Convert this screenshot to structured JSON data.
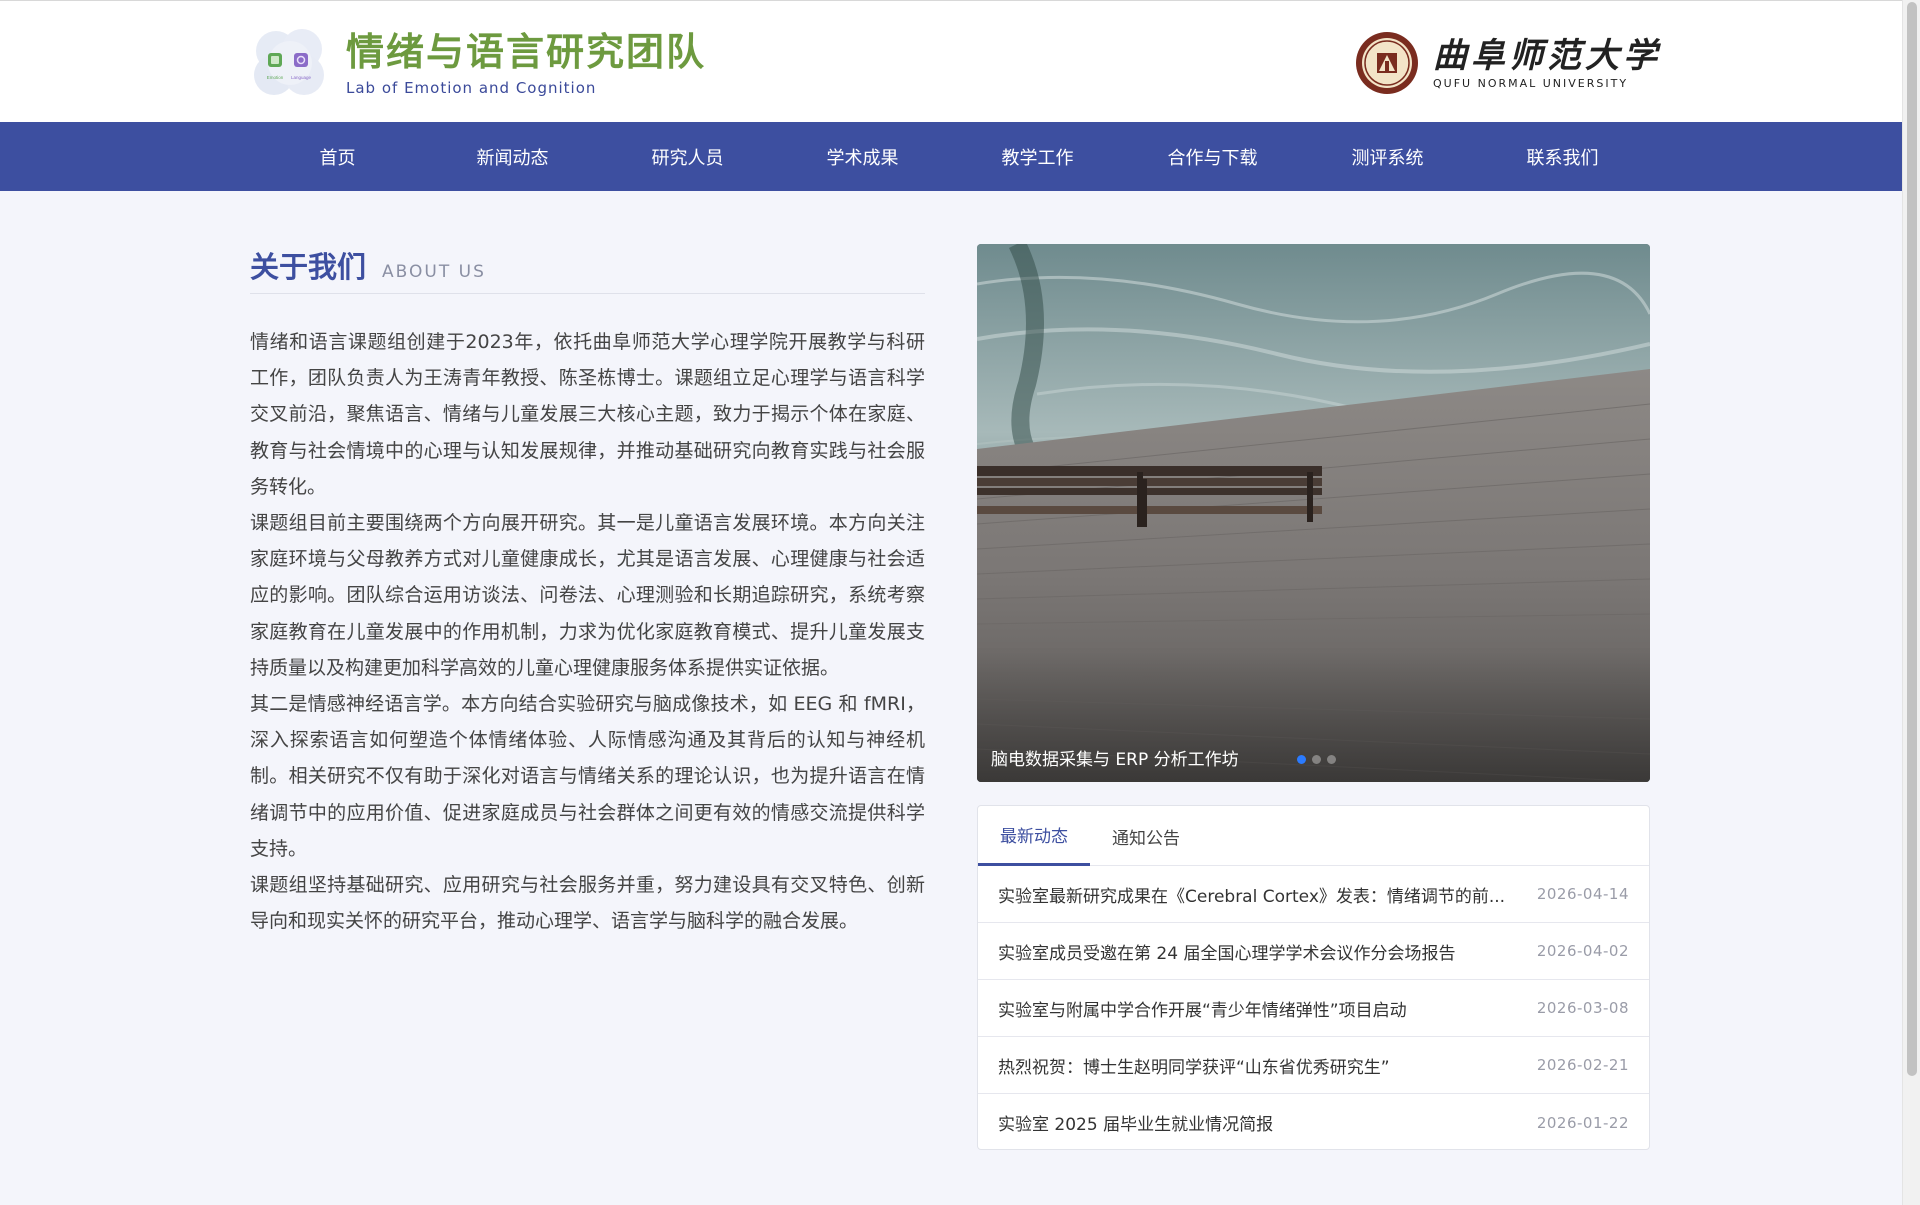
{
  "header": {
    "brand_title": "情绪与语言研究团队",
    "brand_subtitle": "Lab of Emotion and Cognition",
    "logo_labels": [
      "Emotion",
      "Language"
    ],
    "university_cn": "曲阜师范大学",
    "university_en": "QUFU NORMAL UNIVERSITY"
  },
  "nav": {
    "items": [
      {
        "label": "首页"
      },
      {
        "label": "新闻动态"
      },
      {
        "label": "研究人员"
      },
      {
        "label": "学术成果"
      },
      {
        "label": "教学工作"
      },
      {
        "label": "合作与下载"
      },
      {
        "label": "测评系统"
      },
      {
        "label": "联系我们"
      }
    ]
  },
  "about": {
    "title": "关于我们",
    "title_en": "ABOUT US",
    "paragraphs": [
      "情绪和语言课题组创建于2023年，依托曲阜师范大学心理学院开展教学与科研工作，团队负责人为王涛青年教授、陈圣栋博士。课题组立足心理学与语言科学交叉前沿，聚焦语言、情绪与儿童发展三大核心主题，致力于揭示个体在家庭、教育与社会情境中的心理与认知发展规律，并推动基础研究向教育实践与社会服务转化。",
      "课题组目前主要围绕两个方向展开研究。其一是儿童语言发展环境。本方向关注家庭环境与父母教养方式对儿童健康成长，尤其是语言发展、心理健康与社会适应的影响。团队综合运用访谈法、问卷法、心理测验和长期追踪研究，系统考察家庭教育在儿童发展中的作用机制，力求为优化家庭教育模式、提升儿童发展支持质量以及构建更加科学高效的儿童心理健康服务体系提供实证依据。",
      "其二是情感神经语言学。本方向结合实验研究与脑成像技术，如 EEG 和 fMRI，深入探索语言如何塑造个体情绪体验、人际情感沟通及其背后的认知与神经机制。相关研究不仅有助于深化对语言与情绪关系的理论认识，也为提升语言在情绪调节中的应用价值、促进家庭成员与社会群体之间更有效的情感交流提供科学支持。",
      "课题组坚持基础研究、应用研究与社会服务并重，努力建设具有交叉特色、创新导向和现实关怀的研究平台，推动心理学、语言学与脑科学的融合发展。"
    ]
  },
  "carousel": {
    "caption": "脑电数据采集与 ERP 分析工作坊",
    "slide_count": 3,
    "active_index": 0,
    "colors": {
      "active_dot": "#2b7bff"
    }
  },
  "news": {
    "tabs": [
      {
        "label": "最新动态",
        "active": true
      },
      {
        "label": "通知公告",
        "active": false
      }
    ],
    "items": [
      {
        "title": "实验室最新研究成果在《Cerebral Cortex》发表：情绪调节的前...",
        "date": "2026-04-14"
      },
      {
        "title": "实验室成员受邀在第 24 届全国心理学学术会议作分会场报告",
        "date": "2026-04-02"
      },
      {
        "title": "实验室与附属中学合作开展“青少年情绪弹性”项目启动",
        "date": "2026-03-08"
      },
      {
        "title": "热烈祝贺：博士生赵明同学获评“山东省优秀研究生”",
        "date": "2026-02-21"
      },
      {
        "title": "实验室 2025 届毕业生就业情况简报",
        "date": "2026-01-22"
      }
    ]
  },
  "theme": {
    "primary": "#3d4fa0",
    "brand_green": "#6d9a3f",
    "page_bg": "#f4f5fb"
  }
}
